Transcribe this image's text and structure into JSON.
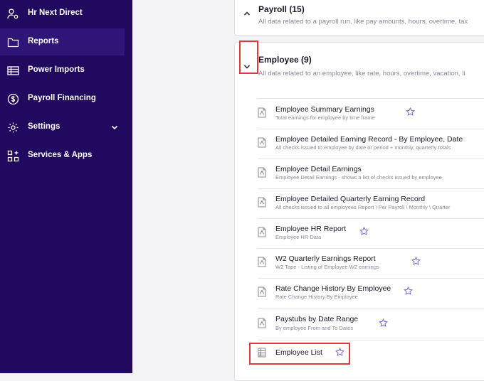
{
  "sidebar": {
    "items": [
      {
        "label": "Hr Next Direct",
        "icon": "person-gear-icon"
      },
      {
        "label": "Reports",
        "icon": "folder-icon",
        "active": true
      },
      {
        "label": "Power Imports",
        "icon": "table-icon"
      },
      {
        "label": "Payroll Financing",
        "icon": "dollar-circle-icon"
      },
      {
        "label": "Settings",
        "icon": "gear-icon",
        "has_chevron": true
      },
      {
        "label": "Services & Apps",
        "icon": "apps-icon"
      }
    ]
  },
  "payroll": {
    "title": "Payroll (15)",
    "desc": "All data related to a payroll run, like pay amounts, hours, overtime, tax"
  },
  "employee": {
    "title": "Employee (9)",
    "desc": "All data related to an employee, like rate, hours, overtime, vacation, li",
    "reports": [
      {
        "title": "Employee Summary Earnings",
        "desc": "Total earnings for employee by time frame",
        "icon": "pdf-icon"
      },
      {
        "title": "Employee Detailed Earning Record - By Employee, Date",
        "desc": "All checks issued to employee by date or period + monthly, quarterly totals",
        "icon": "pdf-icon"
      },
      {
        "title": "Employee Detail Earnings",
        "desc": "Employee Detail Earnings - shows a list of checks issued by employee",
        "icon": "pdf-icon"
      },
      {
        "title": "Employee Detailed Quarterly Earning Record",
        "desc": "All checks issued to all employees Report \\ Per Payroll \\ Monthly \\ Quarter",
        "icon": "pdf-icon"
      },
      {
        "title": "Employee HR Report",
        "desc": "Employee HR Data",
        "icon": "pdf-icon"
      },
      {
        "title": "W2 Quarterly Earnings Report",
        "desc": "W2 Tape - Listing of Employee W2 earnings",
        "icon": "pdf-icon"
      },
      {
        "title": "Rate Change History By Employee",
        "desc": "Rate Change History By Employee",
        "icon": "pdf-icon"
      },
      {
        "title": "Paystubs by Date Range",
        "desc": "By employee From and To Dates",
        "icon": "pdf-icon"
      },
      {
        "title": "Employee List",
        "desc": "",
        "icon": "spreadsheet-icon"
      }
    ]
  },
  "colors": {
    "sidebar_bg": "#20095e",
    "sidebar_active": "#2e1577",
    "highlight": "#e03b3b",
    "star": "#7a6ad8"
  }
}
